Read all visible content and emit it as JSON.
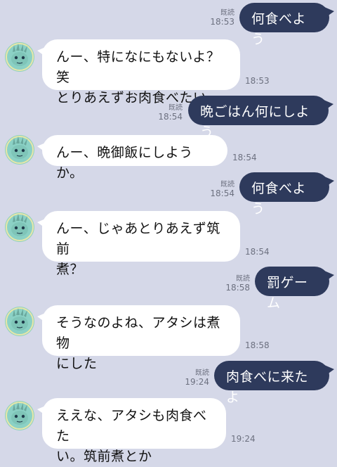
{
  "chat": {
    "read_label": "既読",
    "messages": [
      {
        "type": "sent",
        "text": "何食べよう",
        "time": "18:53",
        "read": "既読"
      },
      {
        "type": "recv",
        "text": "んー、特になにもないよ？笑\nとりあえずお肉食べたい",
        "time": "18:53"
      },
      {
        "type": "sent",
        "text": "晩ごはん何にしよう",
        "time": "18:54",
        "read": "既読"
      },
      {
        "type": "recv",
        "text": "んー、晩御飯にしようか。",
        "time": "18:54"
      },
      {
        "type": "sent",
        "text": "何食べよう",
        "time": "18:54",
        "read": "既読"
      },
      {
        "type": "recv",
        "text": "んー、じゃあとりあえず筑前\n煮？",
        "time": "18:54"
      },
      {
        "type": "sent",
        "text": "罰ゲーム",
        "time": "18:58",
        "read": "既読"
      },
      {
        "type": "recv",
        "text": "そうなのよね、アタシは煮物\nにした",
        "time": "18:58"
      },
      {
        "type": "sent",
        "text": "肉食べに来たよ",
        "time": "19:24",
        "read": "既読"
      },
      {
        "type": "recv",
        "text": "ええな、アタシも肉食べた\nい。筑前煮とか",
        "time": "19:24"
      }
    ]
  },
  "colors": {
    "background": "#d5d8e8",
    "sent_bubble": "#2e3a5c",
    "recv_bubble": "#ffffff",
    "avatar": "#8bd1c5"
  },
  "icons": {
    "avatar": "statue-of-liberty-face-icon"
  }
}
